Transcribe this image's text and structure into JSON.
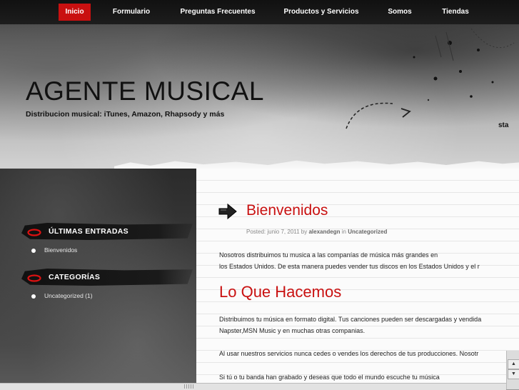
{
  "nav": {
    "items": [
      {
        "label": "Inicio",
        "active": true
      },
      {
        "label": "Formulario"
      },
      {
        "label": "Preguntas Frecuentes"
      },
      {
        "label": "Productos y Servicios"
      },
      {
        "label": "Somos"
      },
      {
        "label": "Tiendas"
      }
    ]
  },
  "header": {
    "title": "AGENTE MUSICAL",
    "tagline": "Distribucion musical: iTunes, Amazon, Rhapsody y más",
    "edge_text": "sta"
  },
  "sidebar": {
    "widgets": [
      {
        "title": "ÚLTIMAS ENTRADAS",
        "items": [
          "Bienvenidos"
        ]
      },
      {
        "title": "CATEGORÍAS",
        "items": [
          "Uncategorized (1)"
        ]
      }
    ]
  },
  "post": {
    "title": "Bienvenidos",
    "meta_prefix": "Posted: junio 7, 2011 by",
    "author": "alexandegn",
    "meta_in": "in",
    "category": "Uncategorized",
    "intro_line1": "Nosotros distribuimos tu musica a las companías de música más grandes en",
    "intro_line2": "los Estados Unidos. De esta manera puedes vender tus  discos en los Estados Unidos y el r",
    "section_title": "Lo Que Hacemos",
    "para1_line1": "Distribuimos tu música en formato digital. Tus canciones pueden ser descargadas y vendida",
    "para1_line2": "Napster,MSN Music y en  muchas otras companias.",
    "para2": "Al usar nuestros servicios nunca cedes o vendes los derechos de tus producciones. Nosotr",
    "para3": "Si tú o tu banda han grabado y deseas que todo el mundo escuche tu música"
  },
  "colors": {
    "accent": "#c91010",
    "nav_bg": "#111111"
  },
  "icons": [
    "arrow-right-icon",
    "red-ring-icon",
    "bullet-icon",
    "scroll-up-icon",
    "scroll-down-icon"
  ]
}
